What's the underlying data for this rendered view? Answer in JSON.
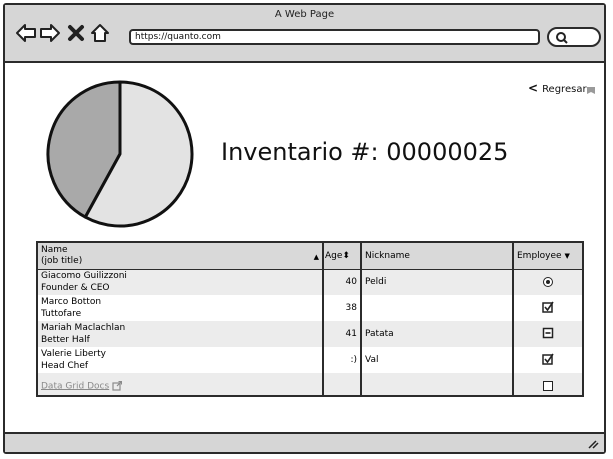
{
  "window": {
    "title": "A Web Page",
    "url": "https://quanto.com"
  },
  "nav": {
    "back_icon": "back-arrow-icon",
    "forward_icon": "forward-arrow-icon",
    "close_icon": "close-x-icon",
    "home_icon": "home-icon",
    "search_icon": "search-icon"
  },
  "page": {
    "back_label": "Regresar",
    "heading": "Inventario #: 00000025",
    "pie_chart": {
      "slices_fraction": [
        0.42,
        0.58
      ],
      "colors": [
        "#a9a9a9",
        "#e3e3e3"
      ]
    }
  },
  "grid": {
    "header": {
      "name_line1": "Name",
      "name_line2": "(job title)",
      "age": "Age",
      "nickname": "Nickname",
      "employee": "Employee"
    },
    "rows": [
      {
        "name": "Giacomo Guilizzoni",
        "title": "Founder & CEO",
        "age": "40",
        "nickname": "Peldi",
        "employee": "radio-selected"
      },
      {
        "name": "Marco Botton",
        "title": "Tuttofare",
        "age": "38",
        "nickname": "",
        "employee": "checked"
      },
      {
        "name": "Mariah Maclachlan",
        "title": "Better Half",
        "age": "41",
        "nickname": "Patata",
        "employee": "indeterminate"
      },
      {
        "name": "Valerie Liberty",
        "title": "Head Chef",
        "age": ":)",
        "nickname": "Val",
        "employee": "checked"
      }
    ],
    "docs_link": "Data Grid Docs",
    "last_row_employee": "unchecked"
  }
}
